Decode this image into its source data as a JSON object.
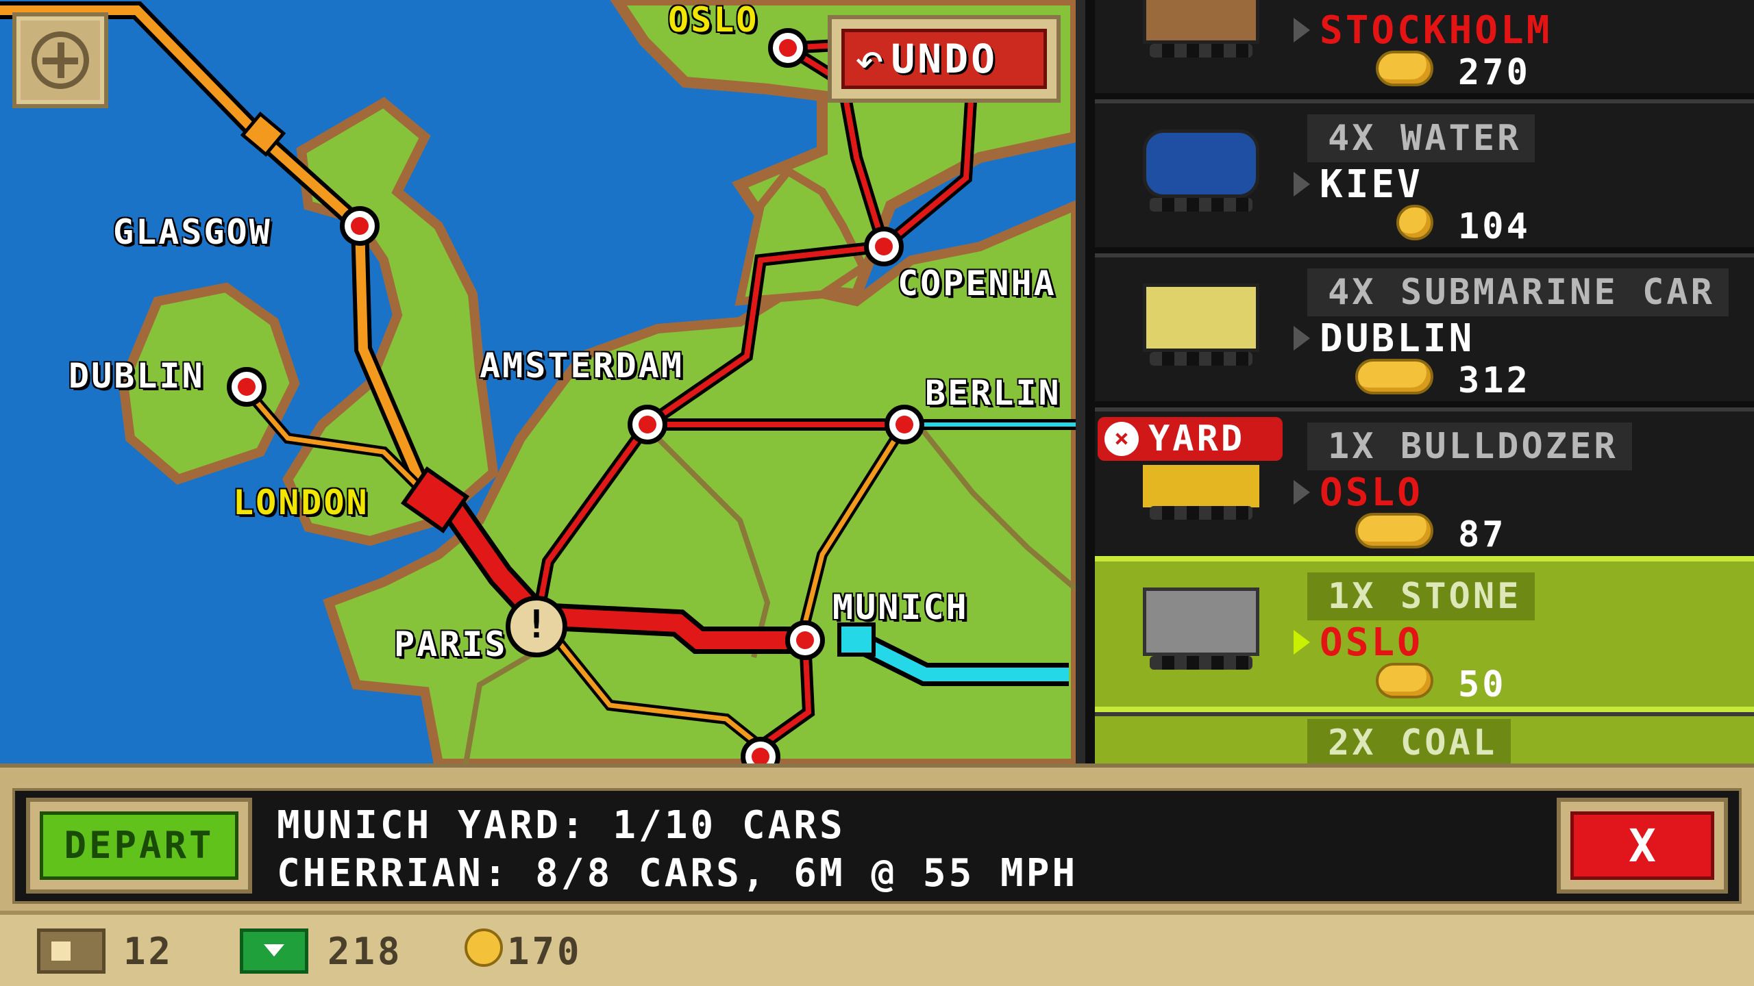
{
  "map": {
    "cities": [
      {
        "name": "OSLO",
        "color": "yellow"
      },
      {
        "name": "GLASGOW",
        "color": "white"
      },
      {
        "name": "DUBLIN",
        "color": "white"
      },
      {
        "name": "AMSTERDAM",
        "color": "white"
      },
      {
        "name": "BERLIN",
        "color": "white"
      },
      {
        "name": "COPENHA",
        "color": "white"
      },
      {
        "name": "LONDON",
        "color": "yellow"
      },
      {
        "name": "PARIS",
        "color": "white"
      },
      {
        "name": "MUNICH",
        "color": "white"
      }
    ],
    "undo_label": "UNDO",
    "zoom_icon": "plus-icon"
  },
  "cargo": [
    {
      "qty": "",
      "dest": "STOCKHOLM",
      "dest_red": true,
      "price": "270",
      "car_color": "#9a6a3c"
    },
    {
      "qty": "4X WATER",
      "dest": "KIEV",
      "dest_red": false,
      "price": "104",
      "car_color": "#1e4fa3"
    },
    {
      "qty": "4X SUBMARINE CAR",
      "dest": "DUBLIN",
      "dest_red": false,
      "price": "312",
      "car_color": "#e0d26a"
    },
    {
      "qty": "1X BULLDOZER",
      "dest": "OSLO",
      "dest_red": true,
      "price": "87",
      "car_color": "#e4b722",
      "badge": "YARD"
    },
    {
      "qty": "1X STONE",
      "dest": "OSLO",
      "dest_red": true,
      "price": "50",
      "car_color": "#8a8a8a",
      "selected": true
    },
    {
      "qty": "2X COAL",
      "dest": "",
      "dest_red": false,
      "price": "",
      "car_color": "#333333"
    }
  ],
  "info": {
    "depart_label": "DEPART",
    "line1": "MUNICH YARD: 1/10 CARS",
    "line2": "CHERRIAN: 8/8 CARS, 6M @ 55 MPH",
    "close_label": "X"
  },
  "resources": {
    "items_count": "12",
    "cash": "218",
    "coins": "170"
  },
  "colors": {
    "sea": "#1b73c8",
    "land": "#86c23a",
    "red_line": "#e01818",
    "orange_line": "#f39a1e",
    "cyan_line": "#24d8e8",
    "selected_row": "#8fb020"
  }
}
